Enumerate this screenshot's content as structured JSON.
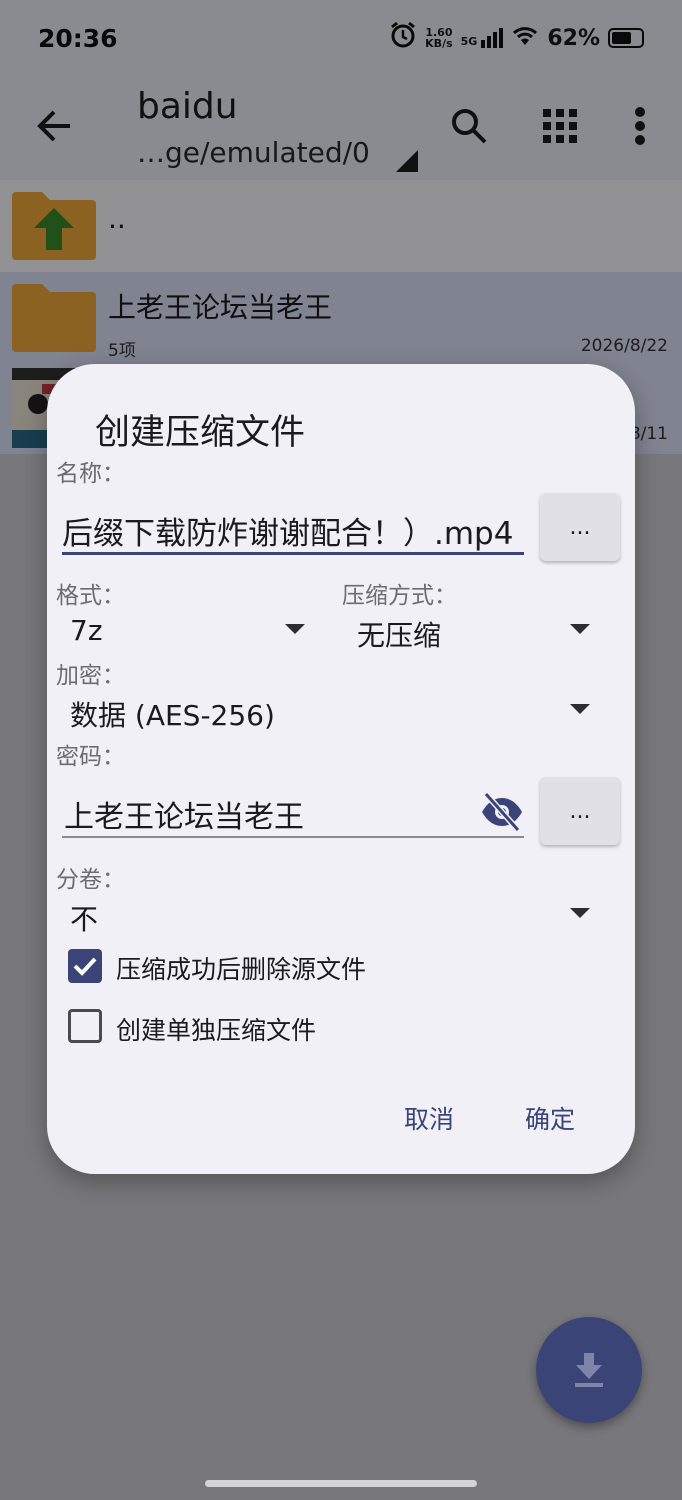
{
  "status_bar": {
    "time": "20:36",
    "net_speed_value": "1.60",
    "net_speed_unit": "KB/s",
    "network": "5G",
    "battery": "62%"
  },
  "toolbar": {
    "title": "baidu",
    "path": "…ge/emulated/0"
  },
  "file_list": [
    {
      "name": "..",
      "meta": "",
      "date": ""
    },
    {
      "name": "上老王论坛当老王",
      "meta": "5项",
      "date": "2026/8/22"
    },
    {
      "name": "",
      "meta": "",
      "date": "8/11"
    }
  ],
  "dialog": {
    "title": "创建压缩文件",
    "name_label": "名称：",
    "name_value": "后缀下载防炸谢谢配合！）.mp4",
    "more_button": "...",
    "format_label": "格式：",
    "format_value": "7z",
    "compression_label": "压缩方式：",
    "compression_value": "无压缩",
    "encryption_label": "加密：",
    "encryption_value": "数据 (AES-256)",
    "password_label": "密码：",
    "password_value": "上老王论坛当老王",
    "volume_label": "分卷：",
    "volume_value": "不",
    "checkbox_delete": {
      "label": "压缩成功后删除源文件",
      "checked": true
    },
    "checkbox_separate": {
      "label": "创建单独压缩文件",
      "checked": false
    },
    "cancel": "取消",
    "ok": "确定"
  },
  "colors": {
    "accent": "#3b4476",
    "folder": "#f2a93b",
    "dialog_bg": "#f1f0f7"
  }
}
